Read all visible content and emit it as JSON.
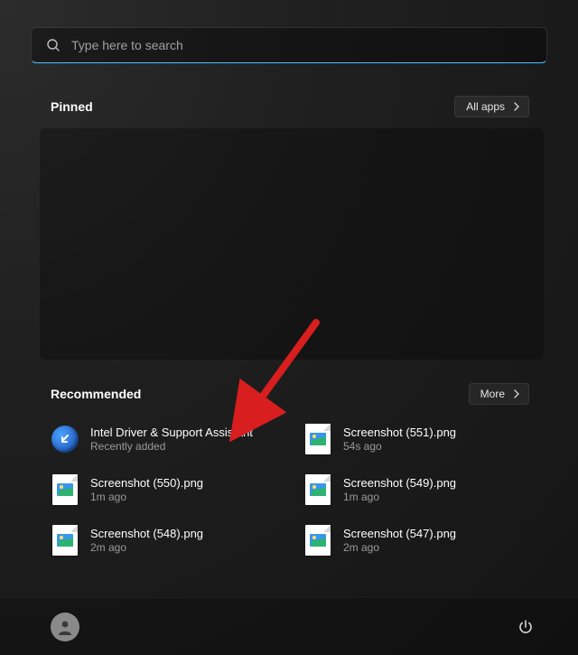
{
  "search": {
    "placeholder": "Type here to search",
    "value": ""
  },
  "pinned": {
    "title": "Pinned",
    "all_apps_label": "All apps"
  },
  "recommended": {
    "title": "Recommended",
    "more_label": "More",
    "items": [
      {
        "title": "Intel Driver & Support Assistant",
        "subtitle": "Recently added",
        "icon": "intel"
      },
      {
        "title": "Screenshot (551).png",
        "subtitle": "54s ago",
        "icon": "image"
      },
      {
        "title": "Screenshot (550).png",
        "subtitle": "1m ago",
        "icon": "image"
      },
      {
        "title": "Screenshot (549).png",
        "subtitle": "1m ago",
        "icon": "image"
      },
      {
        "title": "Screenshot (548).png",
        "subtitle": "2m ago",
        "icon": "image"
      },
      {
        "title": "Screenshot (547).png",
        "subtitle": "2m ago",
        "icon": "image"
      }
    ]
  },
  "colors": {
    "accent": "#4cc2ff",
    "arrow": "#d81e1e"
  }
}
